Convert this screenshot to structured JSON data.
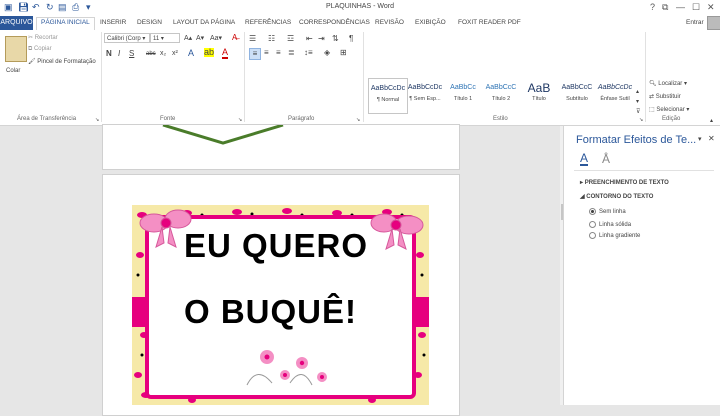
{
  "window": {
    "title": "PLAQUINHAS - Word",
    "help": "?",
    "restore": "⧉",
    "minimize": "—",
    "maximize": "☐",
    "close": "✕",
    "signin": "Entrar"
  },
  "tabs": [
    "ARQUIVO",
    "PÁGINA INICIAL",
    "INSERIR",
    "DESIGN",
    "LAYOUT DA PÁGINA",
    "REFERÊNCIAS",
    "CORRESPONDÊNCIAS",
    "REVISÃO",
    "EXIBIÇÃO",
    "FOXIT READER PDF"
  ],
  "clipboard": {
    "paste": "Colar",
    "cut": "Recortar",
    "copy": "Copiar",
    "format_painter": "Pincel de Formatação",
    "label": "Área de Transferência"
  },
  "font": {
    "name": "Calibri (Corp",
    "size": "11",
    "grow": "A▴",
    "shrink": "A▾",
    "case": "Aa▾",
    "bold": "N",
    "italic": "I",
    "underline": "S",
    "strike": "abc",
    "sub": "x₂",
    "sup": "x²",
    "label": "Fonte"
  },
  "paragraph": {
    "label": "Parágrafo",
    "pilcrow": "¶"
  },
  "styles": {
    "label": "Estilo",
    "items": [
      {
        "preview": "AaBbCcDc",
        "name": "¶ Normal"
      },
      {
        "preview": "AaBbCcDc",
        "name": "¶ Sem Esp..."
      },
      {
        "preview": "AaBbCc",
        "name": "Título 1"
      },
      {
        "preview": "AaBbCcC",
        "name": "Título 2"
      },
      {
        "preview": "AaB",
        "name": "Título"
      },
      {
        "preview": "AaBbCcC",
        "name": "Subtítulo"
      },
      {
        "preview": "AaBbCcDc",
        "name": "Ênfase Sutil"
      }
    ]
  },
  "editing": {
    "find": "Localizar",
    "replace": "Substituir",
    "select": "Selecionar",
    "label": "Edição"
  },
  "pane": {
    "title": "Formatar Efeitos de Te...",
    "section_fill": "PREENCHIMENTO DE TEXTO",
    "section_outline": "CONTORNO DO TEXTO",
    "options": [
      "Sem linha",
      "Linha sólida",
      "Linha gradiente"
    ],
    "selected_option": "Sem linha"
  },
  "card": {
    "line1": "EU QUERO",
    "line2": "O BUQUÊ!"
  },
  "colors": {
    "accent": "#2b579a",
    "pink": "#e6007e",
    "leopard_bg": "#f6e9a8"
  }
}
